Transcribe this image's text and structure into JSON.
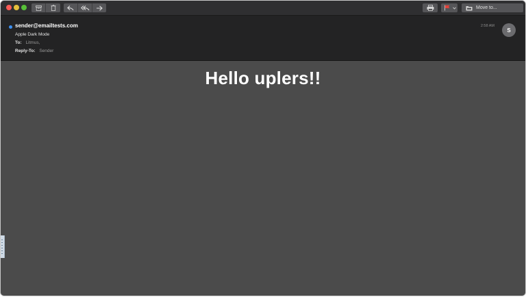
{
  "toolbar": {
    "move_to_label": "Move to..."
  },
  "header": {
    "sender": "sender@emailtests.com",
    "subject": "Apple Dark Mode",
    "to_label": "To:",
    "to_value": "Litmus,",
    "reply_to_label": "Reply-To:",
    "reply_to_value": "Sender",
    "time": "2:58 AM",
    "avatar_initial": "S"
  },
  "body": {
    "headline": "Hello uplers!!"
  },
  "colors": {
    "background": "#4b4b4b",
    "header": "#232324",
    "toolbar": "#2f2f31",
    "unread_dot": "#3c8ff0",
    "flag": "#e0433a"
  },
  "icons": {
    "toolbar": [
      "archive-icon",
      "trash-icon",
      "reply-icon",
      "reply-all-icon",
      "forward-icon",
      "print-icon",
      "flag-icon",
      "chevron-down-icon",
      "folder-icon"
    ]
  }
}
